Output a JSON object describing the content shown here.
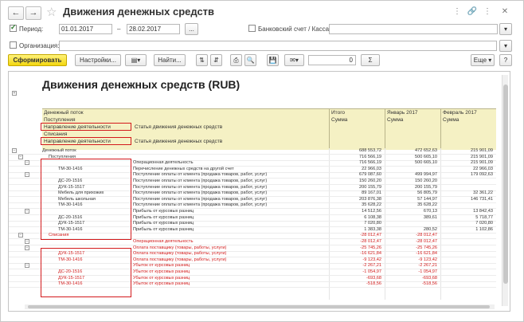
{
  "window": {
    "title": "Движения денежных средств",
    "icons": [
      "more-icon",
      "link-icon",
      "more-vert-icon",
      "close-icon"
    ]
  },
  "form": {
    "period_label": "Период:",
    "date_from": "01.01.2017",
    "date_sep": "–",
    "date_to": "28.02.2017",
    "period_btn": "...",
    "bank_label": "Банковский счет / Касса:",
    "org_label": "Организация:"
  },
  "toolbar": {
    "generate": "Сформировать",
    "settings": "Настройки...",
    "find": "Найти...",
    "amount": "0",
    "sigma": "Σ",
    "more": "Еще",
    "help": "?"
  },
  "report": {
    "title": "Движения денежных средств (RUB)",
    "header": {
      "r1": "Денежный поток",
      "r2": "Поступления",
      "r3a": "Направление деятельности",
      "r3b": "Статья движения денежных средств",
      "r4": "Списания",
      "r5a": "Направление деятельности",
      "r5b": "Статья движения денежных средств",
      "col_total": "Итого",
      "col_jan": "Январь 2017",
      "col_feb": "Февраль 2017",
      "sum": "Сумма"
    },
    "rows": [
      {
        "a": "Денежный поток",
        "b": "",
        "t": "688 553,72",
        "j": "472 652,63",
        "f": "215 901,09",
        "neg": false,
        "lvl": 0
      },
      {
        "a": "Поступления",
        "b": "",
        "t": "716 566,19",
        "j": "500 665,10",
        "f": "215 901,09",
        "neg": false,
        "lvl": 1
      },
      {
        "a": "",
        "b": "Операционная деятельность",
        "t": "716 566,19",
        "j": "500 665,10",
        "f": "215 901,09",
        "neg": false,
        "lvl": 2
      },
      {
        "a": "ТМ-30-1416",
        "b": "Перечисление денежных средств на другой счет",
        "t": "22 966,03",
        "j": "",
        "f": "22 966,03",
        "neg": false,
        "lvl": 3
      },
      {
        "a": "",
        "b": "Поступление оплаты от клиента (продажа товаров, работ, услуг)",
        "t": "679 087,60",
        "j": "499 994,97",
        "f": "179 092,63",
        "neg": false,
        "lvl": 2
      },
      {
        "a": "ДС-20-1516",
        "b": "Поступление оплаты от клиента (продажа товаров, работ, услуг)",
        "t": "150 260,20",
        "j": "150 260,20",
        "f": "",
        "neg": false,
        "lvl": 3
      },
      {
        "a": "ДУК-15-1517",
        "b": "Поступление оплаты от клиента (продажа товаров, работ, услуг)",
        "t": "200 155,79",
        "j": "200 155,79",
        "f": "",
        "neg": false,
        "lvl": 3
      },
      {
        "a": "Мебель для прихожих",
        "b": "Поступление оплаты от клиента (продажа товаров, работ, услуг)",
        "t": "89 167,01",
        "j": "56 805,79",
        "f": "32 361,22",
        "neg": false,
        "lvl": 3
      },
      {
        "a": "Мебель школьная",
        "b": "Поступление оплаты от клиента (продажа товаров, работ, услуг)",
        "t": "203 876,38",
        "j": "57 144,97",
        "f": "146 731,41",
        "neg": false,
        "lvl": 3
      },
      {
        "a": "ТМ-30-1416",
        "b": "Поступление оплаты от клиента (продажа товаров, работ, услуг)",
        "t": "35 628,22",
        "j": "35 628,22",
        "f": "",
        "neg": false,
        "lvl": 3
      },
      {
        "a": "",
        "b": "Прибыль от курсовых разниц",
        "t": "14 512,56",
        "j": "670,13",
        "f": "13 842,43",
        "neg": false,
        "lvl": 2
      },
      {
        "a": "ДС-20-1516",
        "b": "Прибыль от курсовых разниц",
        "t": "6 108,38",
        "j": "389,61",
        "f": "5 718,77",
        "neg": false,
        "lvl": 3
      },
      {
        "a": "ДУК-15-1517",
        "b": "Прибыль от курсовых разниц",
        "t": "7 020,80",
        "j": "",
        "f": "7 020,80",
        "neg": false,
        "lvl": 3
      },
      {
        "a": "ТМ-30-1416",
        "b": "Прибыль от курсовых разниц",
        "t": "1 383,38",
        "j": "280,52",
        "f": "1 102,86",
        "neg": false,
        "lvl": 3
      },
      {
        "a": "Списания",
        "b": "",
        "t": "-28 012,47",
        "j": "-28 012,47",
        "f": "",
        "neg": true,
        "lvl": 1
      },
      {
        "a": "",
        "b": "Операционная деятельность",
        "t": "-28 012,47",
        "j": "-28 012,47",
        "f": "",
        "neg": true,
        "lvl": 2
      },
      {
        "a": "",
        "b": "Оплата поставщику (товары, работы, услуги)",
        "t": "-25 745,26",
        "j": "-25 745,26",
        "f": "",
        "neg": true,
        "lvl": 2
      },
      {
        "a": "ДУК-15-1517",
        "b": "Оплата поставщику (товары, работы, услуги)",
        "t": "-16 621,84",
        "j": "-16 621,84",
        "f": "",
        "neg": true,
        "lvl": 3
      },
      {
        "a": "ТМ-30-1416",
        "b": "Оплата поставщику (товары, работы, услуги)",
        "t": "-9 123,42",
        "j": "-9 123,42",
        "f": "",
        "neg": true,
        "lvl": 3
      },
      {
        "a": "",
        "b": "Убыток от курсовых разниц",
        "t": "-2 267,21",
        "j": "-2 267,21",
        "f": "",
        "neg": true,
        "lvl": 2
      },
      {
        "a": "ДС-20-1516",
        "b": "Убыток от курсовых разниц",
        "t": "-1 054,97",
        "j": "-1 054,97",
        "f": "",
        "neg": true,
        "lvl": 3
      },
      {
        "a": "ДУК-15-1517",
        "b": "Убыток от курсовых разниц",
        "t": "-693,68",
        "j": "-693,68",
        "f": "",
        "neg": true,
        "lvl": 3
      },
      {
        "a": "ТМ-30-1416",
        "b": "Убыток от курсовых разниц",
        "t": "-518,56",
        "j": "-518,56",
        "f": "",
        "neg": true,
        "lvl": 3
      }
    ]
  }
}
